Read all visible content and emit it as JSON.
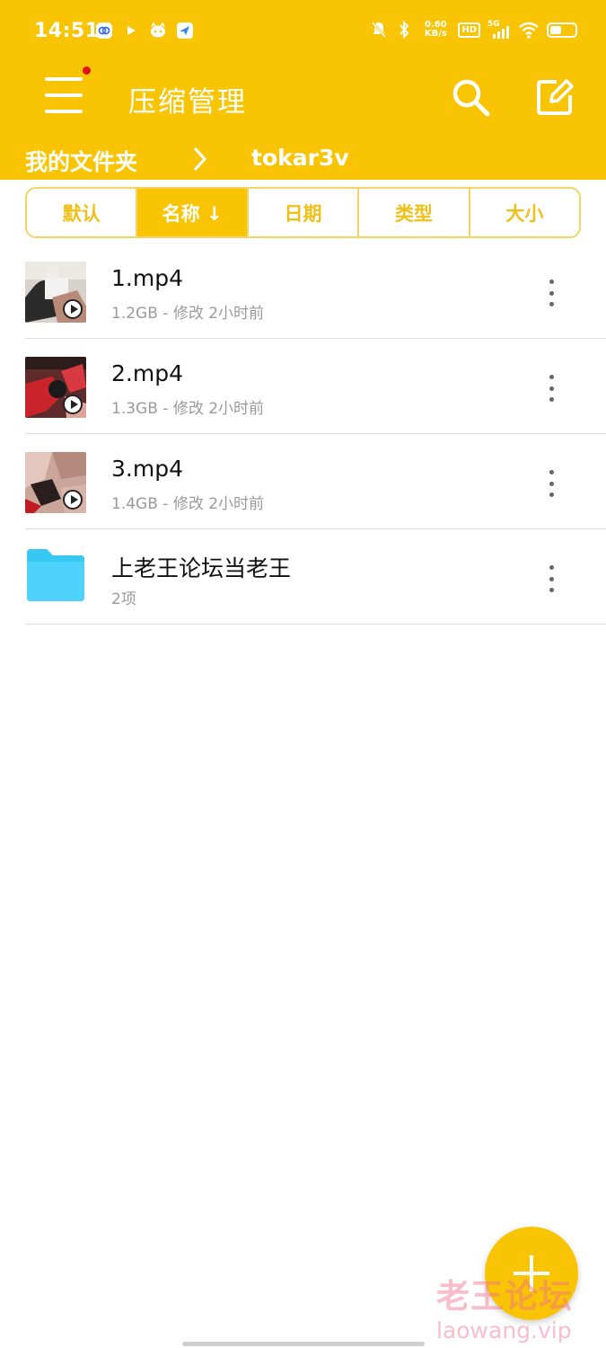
{
  "status": {
    "time": "14:51",
    "net_speed_value": "0.60",
    "net_speed_unit": "KB/s",
    "hd": "HD",
    "network": "5G",
    "battery_level": 0.45
  },
  "appbar": {
    "title": "压缩管理",
    "menu_badge": true
  },
  "breadcrumb": {
    "root": "我的文件夹",
    "current": "tokar3v"
  },
  "sort": {
    "options": [
      "默认",
      "名称 ↓",
      "日期",
      "类型",
      "大小"
    ],
    "active_index": 1
  },
  "files": [
    {
      "name": "1.mp4",
      "meta": "1.2GB - 修改 2小时前",
      "type": "video"
    },
    {
      "name": "2.mp4",
      "meta": "1.3GB - 修改 2小时前",
      "type": "video"
    },
    {
      "name": "3.mp4",
      "meta": "1.4GB - 修改 2小时前",
      "type": "video"
    },
    {
      "name": "上老王论坛当老王",
      "meta": "2项",
      "type": "folder"
    }
  ],
  "watermark": {
    "line1": "老王论坛",
    "line2": "laowang.vip"
  },
  "colors": {
    "accent": "#f9c404",
    "folder": "#38c8f4"
  }
}
